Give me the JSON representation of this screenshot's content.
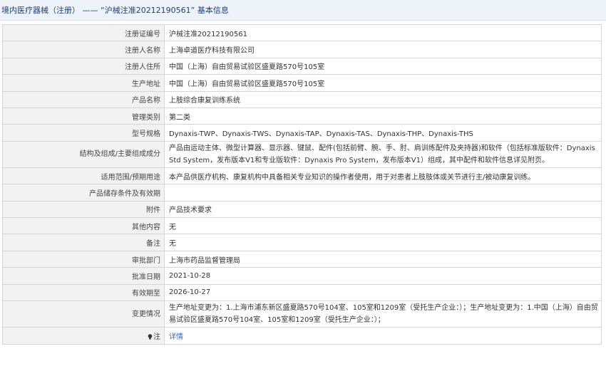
{
  "header": {
    "title": "境内医疗器械（注册） —— “沪械注准20212190561” 基本信息"
  },
  "rows": [
    {
      "label": "注册证编号",
      "value": "沪械注准20212190561"
    },
    {
      "label": "注册人名称",
      "value": "上海卓道医疗科技有限公司"
    },
    {
      "label": "注册人住所",
      "value": "中国（上海）自由贸易试验区盛夏路570号105室"
    },
    {
      "label": "生产地址",
      "value": "中国（上海）自由贸易试验区盛夏路570号105室"
    },
    {
      "label": "产品名称",
      "value": "上肢综合康复训练系统"
    },
    {
      "label": "管理类别",
      "value": "第二类"
    },
    {
      "label": "型号规格",
      "value": "Dynaxis-TWP、Dynaxis-TWS、Dynaxis-TAP、Dynaxis-TAS、Dynaxis-THP、Dynaxis-THS"
    },
    {
      "label": "结构及组成/主要组成成分",
      "value": "产品由运动主体、微型计算器、显示器、键鼠、配件(包括前臂、腕、手、肘、肩训练配件及夹持器)和软件（包括标准版软件：Dynaxis Std System，发布版本V1和专业版软件：Dynaxis Pro System，发布版本V1）组成，其中配件和软件信息详见附页。"
    },
    {
      "label": "适用范围/预期用途",
      "value": "本产品供医疗机构、康复机构中具备相关专业知识的操作者使用，用于对患者上肢肢体或关节进行主/被动康复训练。"
    },
    {
      "label": "产品储存条件及有效期",
      "value": ""
    },
    {
      "label": "附件",
      "value": "产品技术要求"
    },
    {
      "label": "其他内容",
      "value": "无"
    },
    {
      "label": "备注",
      "value": "无"
    },
    {
      "label": "审批部门",
      "value": "上海市药品监督管理局"
    },
    {
      "label": "批准日期",
      "value": "2021-10-28"
    },
    {
      "label": "有效期至",
      "value": "2026-10-27"
    },
    {
      "label": "变更情况",
      "value": "生产地址变更为：1.上海市浦东新区盛夏路570号104室、105室和1209室（受托生产企业：）；生产地址变更为：1.中国（上海）自由贸易试验区盛夏路570号104室、105室和1209室（受托生产企业：）；"
    }
  ],
  "note": {
    "label": "注",
    "link_text": "详情",
    "icon": "lightbulb-icon"
  },
  "colors": {
    "title_text": "#1f3f7a",
    "header_bg": "#eef2f9",
    "label_bg": "#f2f2f2",
    "link": "#2f6dbd"
  }
}
